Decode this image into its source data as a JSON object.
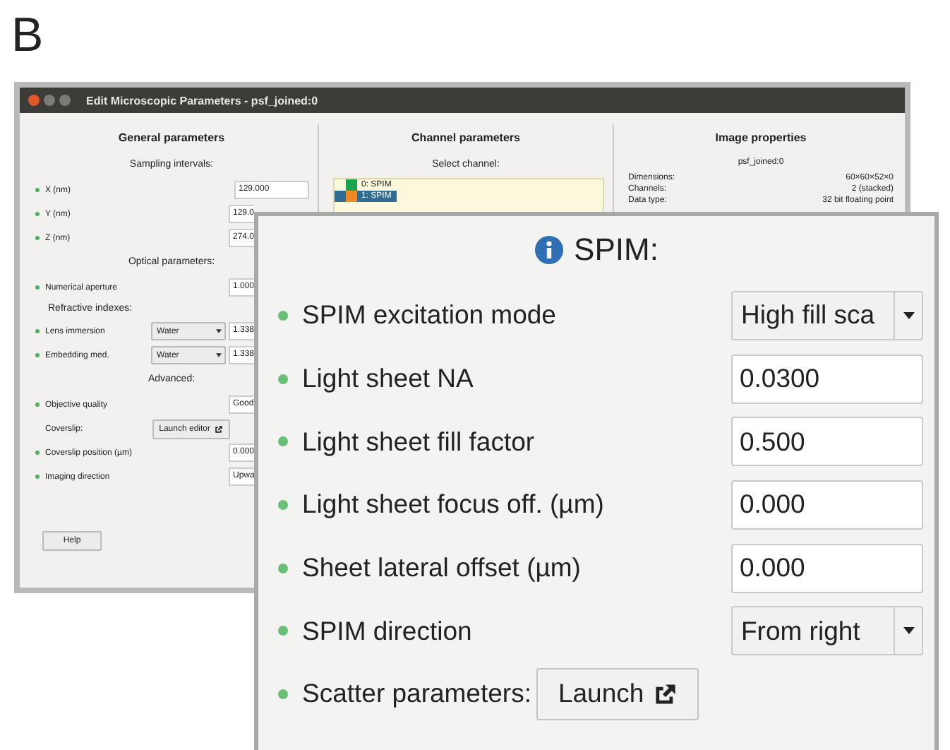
{
  "figure_label": "B",
  "window": {
    "title": "Edit Microscopic Parameters - psf_joined:0"
  },
  "general": {
    "title": "General parameters",
    "rows": [
      {
        "kind": "section",
        "text": "Sampling intervals:"
      },
      {
        "kind": "field",
        "label": "X (nm)",
        "dot": true,
        "value": "129.000"
      },
      {
        "kind": "field",
        "label": "Y (nm)",
        "dot": true,
        "value": "129.0"
      },
      {
        "kind": "field",
        "label": "Z (nm)",
        "dot": true,
        "value": "274.0"
      },
      {
        "kind": "section",
        "text": "Optical parameters:"
      },
      {
        "kind": "field",
        "label": "Numerical aperture",
        "dot": true,
        "value": "1.000"
      },
      {
        "kind": "group",
        "text": "Refractive indexes:"
      },
      {
        "kind": "combo",
        "label": "Lens immersion",
        "dot": true,
        "option": "Water",
        "value": "1.338"
      },
      {
        "kind": "combo",
        "label": "Embedding med.",
        "dot": true,
        "option": "Water",
        "value": "1.338"
      },
      {
        "kind": "section",
        "text": "Advanced:"
      },
      {
        "kind": "field",
        "label": "Objective quality",
        "dot": true,
        "value": "Good"
      },
      {
        "kind": "button",
        "label": "Coverslip:",
        "dot": false,
        "button": "Launch editor"
      },
      {
        "kind": "field",
        "label": "Coverslip position (µm)",
        "dot": true,
        "value": "0.000"
      },
      {
        "kind": "field",
        "label": "Imaging direction",
        "dot": true,
        "value": "Upwa"
      }
    ]
  },
  "help_button": "Help",
  "channel": {
    "title": "Channel parameters",
    "subtitle": "Select channel:",
    "channels": [
      {
        "label": "0: SPIM",
        "color": "#1aa350",
        "selected": false
      },
      {
        "label": "1: SPIM",
        "color": "#f08a24",
        "selected": true
      }
    ]
  },
  "image": {
    "title": "Image properties",
    "name": "psf_joined:0",
    "props": [
      {
        "key": "Dimensions:",
        "value": "60×60×52×0"
      },
      {
        "key": "Channels:",
        "value": "2 (stacked)"
      },
      {
        "key": "Data type:",
        "value": "32 bit floating point"
      }
    ]
  },
  "spim": {
    "title": "SPIM:",
    "rows": [
      {
        "kind": "combo",
        "label": "SPIM excitation mode",
        "value": "High fill sca"
      },
      {
        "kind": "field",
        "label": "Light sheet NA",
        "value": "0.0300"
      },
      {
        "kind": "field",
        "label": "Light sheet fill factor",
        "value": "0.500"
      },
      {
        "kind": "field",
        "label": "Light sheet focus off. (µm)",
        "value": "0.000"
      },
      {
        "kind": "field",
        "label": "Sheet lateral offset (µm)",
        "value": "0.000"
      },
      {
        "kind": "combo",
        "label": "SPIM direction",
        "value": "From right"
      },
      {
        "kind": "button",
        "label": "Scatter parameters:",
        "button": "Launch"
      }
    ]
  }
}
